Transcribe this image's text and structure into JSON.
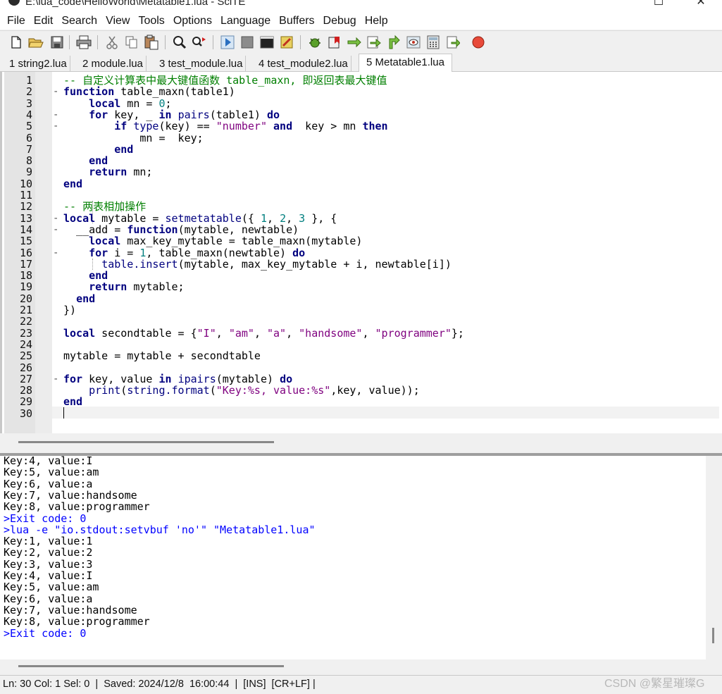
{
  "window": {
    "title": "E:\\lua_code\\HelloWorld\\Metatable1.lua - SciTE"
  },
  "menu": [
    "File",
    "Edit",
    "Search",
    "View",
    "Tools",
    "Options",
    "Language",
    "Buffers",
    "Debug",
    "Help"
  ],
  "toolbar": {
    "icons": [
      "new-file-icon",
      "open-folder-icon",
      "save-icon",
      "print-icon",
      "cut-icon",
      "copy-icon",
      "paste-icon",
      "find-icon",
      "replace-icon",
      "run-icon",
      "stop-icon",
      "console-icon",
      "build-icon",
      "debug-icon",
      "bookmark-icon",
      "step-into-icon",
      "step-over-icon",
      "step-out-icon",
      "watch-icon",
      "calculator-icon",
      "export-icon",
      "record-icon"
    ]
  },
  "tabs": [
    {
      "label": "1 string2.lua",
      "active": false
    },
    {
      "label": "2 module.lua",
      "active": false
    },
    {
      "label": "3 test_module.lua",
      "active": false
    },
    {
      "label": "4 test_module2.lua",
      "active": false
    },
    {
      "label": "5 Metatable1.lua",
      "active": true
    }
  ],
  "editor": {
    "lines": [
      {
        "num": "1",
        "fold": "",
        "tokens": [
          [
            "cm",
            "-- 自定义计算表中最大键值函数 table_maxn, 即返回表最大键值"
          ]
        ]
      },
      {
        "num": "2",
        "fold": "-",
        "tokens": [
          [
            "kw",
            "function"
          ],
          [
            "",
            " table_maxn(table1)"
          ]
        ]
      },
      {
        "num": "3",
        "fold": "",
        "tokens": [
          [
            "",
            "    "
          ],
          [
            "kw",
            "local"
          ],
          [
            "",
            " mn = "
          ],
          [
            "nm",
            "0"
          ],
          [
            "",
            ";"
          ]
        ]
      },
      {
        "num": "4",
        "fold": "-",
        "tokens": [
          [
            "",
            "    "
          ],
          [
            "kw",
            "for"
          ],
          [
            "",
            " key, _ "
          ],
          [
            "kw",
            "in"
          ],
          [
            "",
            " "
          ],
          [
            "fn",
            "pairs"
          ],
          [
            "",
            "(table1) "
          ],
          [
            "kw",
            "do"
          ]
        ]
      },
      {
        "num": "5",
        "fold": "-",
        "tokens": [
          [
            "",
            "        "
          ],
          [
            "kw",
            "if"
          ],
          [
            "",
            " "
          ],
          [
            "fn",
            "type"
          ],
          [
            "",
            "(key) == "
          ],
          [
            "st",
            "\"number\""
          ],
          [
            "",
            " "
          ],
          [
            "kw",
            "and"
          ],
          [
            "",
            "  key > mn "
          ],
          [
            "kw",
            "then"
          ]
        ]
      },
      {
        "num": "6",
        "fold": "",
        "tokens": [
          [
            "",
            "            mn =  key;"
          ]
        ]
      },
      {
        "num": "7",
        "fold": "",
        "tokens": [
          [
            "",
            "        "
          ],
          [
            "kw",
            "end"
          ]
        ]
      },
      {
        "num": "8",
        "fold": "",
        "tokens": [
          [
            "",
            "    "
          ],
          [
            "kw",
            "end"
          ]
        ]
      },
      {
        "num": "9",
        "fold": "",
        "tokens": [
          [
            "",
            "    "
          ],
          [
            "kw",
            "return"
          ],
          [
            "",
            " mn;"
          ]
        ]
      },
      {
        "num": "10",
        "fold": "",
        "tokens": [
          [
            "kw",
            "end"
          ]
        ]
      },
      {
        "num": "11",
        "fold": "",
        "tokens": []
      },
      {
        "num": "12",
        "fold": "",
        "tokens": [
          [
            "cm",
            "-- 两表相加操作"
          ]
        ]
      },
      {
        "num": "13",
        "fold": "-",
        "tokens": [
          [
            "kw",
            "local"
          ],
          [
            "",
            " mytable = "
          ],
          [
            "fn",
            "setmetatable"
          ],
          [
            "",
            "({ "
          ],
          [
            "nm",
            "1"
          ],
          [
            "",
            ", "
          ],
          [
            "nm",
            "2"
          ],
          [
            "",
            ", "
          ],
          [
            "nm",
            "3"
          ],
          [
            "",
            " }, {"
          ]
        ]
      },
      {
        "num": "14",
        "fold": "-",
        "tokens": [
          [
            "",
            "  __add = "
          ],
          [
            "kw",
            "function"
          ],
          [
            "",
            "(mytable, newtable)"
          ]
        ]
      },
      {
        "num": "15",
        "fold": "",
        "tokens": [
          [
            "",
            "    "
          ],
          [
            "kw",
            "local"
          ],
          [
            "",
            " max_key_mytable = table_maxn(mytable)"
          ]
        ]
      },
      {
        "num": "16",
        "fold": "-",
        "tokens": [
          [
            "",
            "    "
          ],
          [
            "kw",
            "for"
          ],
          [
            "",
            " i = "
          ],
          [
            "nm",
            "1"
          ],
          [
            "",
            ", table_maxn(newtable) "
          ],
          [
            "kw",
            "do"
          ]
        ]
      },
      {
        "num": "17",
        "fold": "",
        "tokens": [
          [
            "",
            "      "
          ],
          [
            "fn",
            "table.insert"
          ],
          [
            "",
            "(mytable, max_key_mytable + i, newtable[i])"
          ]
        ]
      },
      {
        "num": "18",
        "fold": "",
        "tokens": [
          [
            "",
            "    "
          ],
          [
            "kw",
            "end"
          ]
        ]
      },
      {
        "num": "19",
        "fold": "",
        "tokens": [
          [
            "",
            "    "
          ],
          [
            "kw",
            "return"
          ],
          [
            "",
            " mytable;"
          ]
        ]
      },
      {
        "num": "20",
        "fold": "",
        "tokens": [
          [
            "",
            "  "
          ],
          [
            "kw",
            "end"
          ]
        ]
      },
      {
        "num": "21",
        "fold": "",
        "tokens": [
          [
            "",
            "})"
          ]
        ]
      },
      {
        "num": "22",
        "fold": "",
        "tokens": []
      },
      {
        "num": "23",
        "fold": "",
        "tokens": [
          [
            "kw",
            "local"
          ],
          [
            "",
            " secondtable = {"
          ],
          [
            "st",
            "\"I\""
          ],
          [
            "",
            ", "
          ],
          [
            "st",
            "\"am\""
          ],
          [
            "",
            ", "
          ],
          [
            "st",
            "\"a\""
          ],
          [
            "",
            ", "
          ],
          [
            "st",
            "\"handsome\""
          ],
          [
            "",
            ", "
          ],
          [
            "st",
            "\"programmer\""
          ],
          [
            "",
            "};"
          ]
        ]
      },
      {
        "num": "24",
        "fold": "",
        "tokens": []
      },
      {
        "num": "25",
        "fold": "",
        "tokens": [
          [
            "",
            "mytable = mytable + secondtable"
          ]
        ]
      },
      {
        "num": "26",
        "fold": "",
        "tokens": []
      },
      {
        "num": "27",
        "fold": "-",
        "tokens": [
          [
            "kw",
            "for"
          ],
          [
            "",
            " key, value "
          ],
          [
            "kw",
            "in"
          ],
          [
            "",
            " "
          ],
          [
            "fn",
            "ipairs"
          ],
          [
            "",
            "(mytable) "
          ],
          [
            "kw",
            "do"
          ]
        ]
      },
      {
        "num": "28",
        "fold": "",
        "tokens": [
          [
            "",
            "    "
          ],
          [
            "fn",
            "print"
          ],
          [
            "",
            "("
          ],
          [
            "fn",
            "string.format"
          ],
          [
            "",
            "("
          ],
          [
            "st",
            "\"Key:%s, value:%s\""
          ],
          [
            "",
            ",key, value));"
          ]
        ]
      },
      {
        "num": "29",
        "fold": "",
        "tokens": [
          [
            "kw",
            "end"
          ]
        ]
      },
      {
        "num": "30",
        "fold": "",
        "tokens": []
      }
    ]
  },
  "output": {
    "lines": [
      {
        "text": "Key:4, value:I",
        "blue": false
      },
      {
        "text": "Key:5, value:am",
        "blue": false
      },
      {
        "text": "Key:6, value:a",
        "blue": false
      },
      {
        "text": "Key:7, value:handsome",
        "blue": false
      },
      {
        "text": "Key:8, value:programmer",
        "blue": false
      },
      {
        "text": ">Exit code: 0",
        "blue": true
      },
      {
        "text": ">lua -e \"io.stdout:setvbuf 'no'\" \"Metatable1.lua\"",
        "blue": true
      },
      {
        "text": "Key:1, value:1",
        "blue": false
      },
      {
        "text": "Key:2, value:2",
        "blue": false
      },
      {
        "text": "Key:3, value:3",
        "blue": false
      },
      {
        "text": "Key:4, value:I",
        "blue": false
      },
      {
        "text": "Key:5, value:am",
        "blue": false
      },
      {
        "text": "Key:6, value:a",
        "blue": false
      },
      {
        "text": "Key:7, value:handsome",
        "blue": false
      },
      {
        "text": "Key:8, value:programmer",
        "blue": false
      },
      {
        "text": ">Exit code: 0",
        "blue": true
      }
    ]
  },
  "status": {
    "text": "Ln: 30 Col: 1 Sel: 0  |  Saved: 2024/12/8  16:00:44  |  [INS]  [CR+LF] |"
  },
  "watermark": "CSDN @繁星璀璨G",
  "colors": {
    "keyword": "#00007f",
    "comment": "#007f00",
    "string": "#7f007f",
    "number": "#007f7f",
    "output_meta": "#0000ff"
  }
}
